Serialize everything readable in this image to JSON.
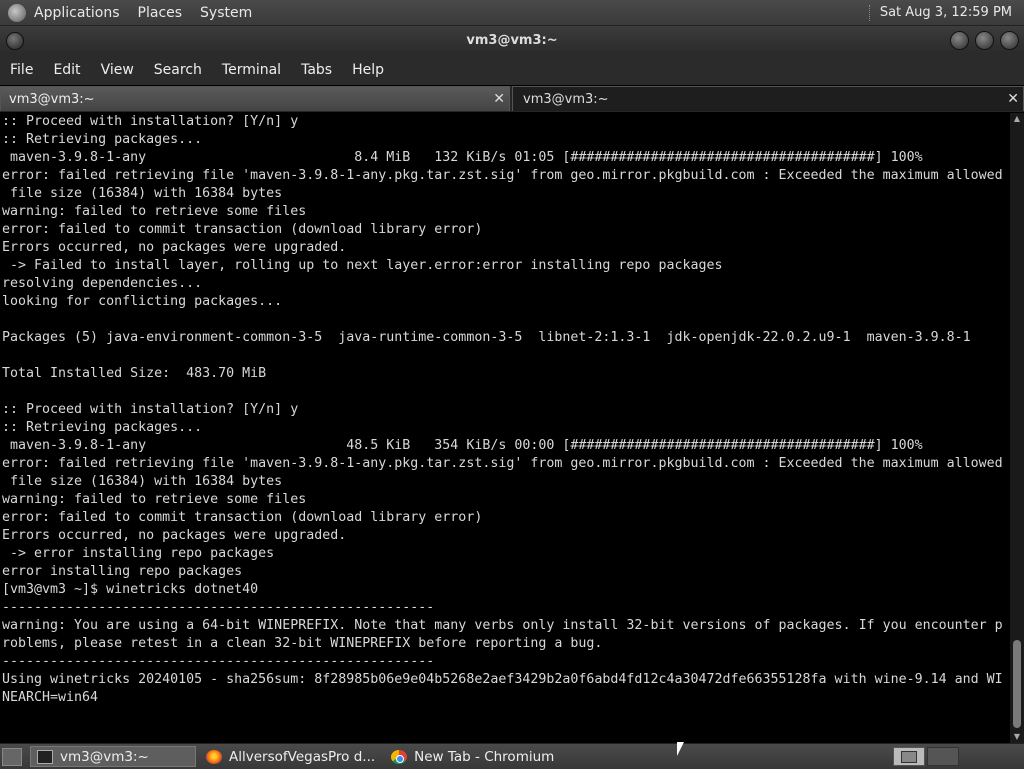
{
  "top_panel": {
    "menus": [
      "Applications",
      "Places",
      "System"
    ],
    "clock": "Sat Aug  3, 12:59 PM"
  },
  "window": {
    "title": "vm3@vm3:~"
  },
  "menubar": [
    "File",
    "Edit",
    "View",
    "Search",
    "Terminal",
    "Tabs",
    "Help"
  ],
  "tabs": [
    {
      "label": "vm3@vm3:~",
      "active": false
    },
    {
      "label": "vm3@vm3:~",
      "active": true
    }
  ],
  "terminal_lines": [
    ":: Proceed with installation? [Y/n] y",
    ":: Retrieving packages...",
    " maven-3.9.8-1-any                          8.4 MiB   132 KiB/s 01:05 [######################################] 100%",
    "error: failed retrieving file 'maven-3.9.8-1-any.pkg.tar.zst.sig' from geo.mirror.pkgbuild.com : Exceeded the maximum allowed",
    " file size (16384) with 16384 bytes",
    "warning: failed to retrieve some files",
    "error: failed to commit transaction (download library error)",
    "Errors occurred, no packages were upgraded.",
    " -> Failed to install layer, rolling up to next layer.error:error installing repo packages",
    "resolving dependencies...",
    "looking for conflicting packages...",
    "",
    "Packages (5) java-environment-common-3-5  java-runtime-common-3-5  libnet-2:1.3-1  jdk-openjdk-22.0.2.u9-1  maven-3.9.8-1",
    "",
    "Total Installed Size:  483.70 MiB",
    "",
    ":: Proceed with installation? [Y/n] y",
    ":: Retrieving packages...",
    " maven-3.9.8-1-any                         48.5 KiB   354 KiB/s 00:00 [######################################] 100%",
    "error: failed retrieving file 'maven-3.9.8-1-any.pkg.tar.zst.sig' from geo.mirror.pkgbuild.com : Exceeded the maximum allowed",
    " file size (16384) with 16384 bytes",
    "warning: failed to retrieve some files",
    "error: failed to commit transaction (download library error)",
    "Errors occurred, no packages were upgraded.",
    " -> error installing repo packages",
    "error installing repo packages",
    "[vm3@vm3 ~]$ winetricks dotnet40",
    "------------------------------------------------------",
    "warning: You are using a 64-bit WINEPREFIX. Note that many verbs only install 32-bit versions of packages. If you encounter p",
    "roblems, please retest in a clean 32-bit WINEPREFIX before reporting a bug.",
    "------------------------------------------------------",
    "Using winetricks 20240105 - sha256sum: 8f28985b06e9e04b5268e2aef3429b2a0f6abd4fd12c4a30472dfe66355128fa with wine-9.14 and WI",
    "NEARCH=win64"
  ],
  "taskbar": [
    {
      "label": "vm3@vm3:~",
      "icon": "terminal-icon",
      "active": true
    },
    {
      "label": "AllversofVegasPro d...",
      "icon": "firefox-icon",
      "active": false
    },
    {
      "label": "New Tab - Chromium",
      "icon": "chromium-icon",
      "active": false
    }
  ]
}
